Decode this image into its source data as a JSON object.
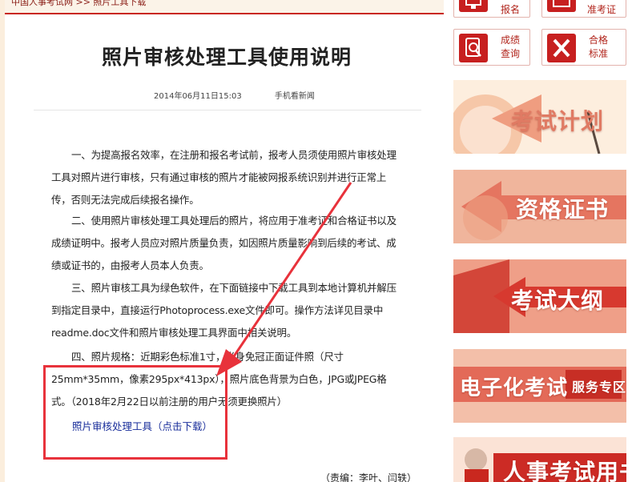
{
  "breadcrumb": "中国人事考试网 >> 照片工具下载",
  "article": {
    "title": "照片审核处理工具使用说明",
    "date": "2014年06月11日15:03",
    "mobile_link": "手机看新闻",
    "paragraphs": [
      "一、为提高报名效率，在注册和报名考试前，报考人员须使用照片审核处理工具对照片进行审核，只有通过审核的照片才能被网报系统识别并进行正常上传，否则无法完成后续报名操作。",
      "二、使用照片审核处理工具处理后的照片，将应用于准考证和合格证书以及成绩证明中。报考人员应对照片质量负责，如因照片质量影响到后续的考试、成绩或证书的，由报考人员本人负责。",
      "三、照片审核工具为绿色软件，在下面链接中下载工具到本地计算机并解压到指定目录中，直接运行Photoprocess.exe文件即可。操作方法详见目录中readme.doc文件和照片审核处理工具界面中相关说明。",
      "四、照片规格：近期彩色标准1寸，半身免冠正面证件照（尺寸25mm*35mm，像素295px*413px），照片底色背景为白色，JPG或JPEG格式。（2018年2月22日以前注册的用户无须更换照片）"
    ],
    "download_link": "照片审核处理工具（点击下载）",
    "editor": "（责编：李叶、闫轶）"
  },
  "sidebar": {
    "top_buttons": [
      {
        "label": "报名",
        "icon": "monitor-icon"
      },
      {
        "label": "准考证",
        "icon": "printer-icon"
      }
    ],
    "buttons": [
      {
        "label_line1": "成绩",
        "label_line2": "查询",
        "icon": "search-icon"
      },
      {
        "label_line1": "合格",
        "label_line2": "标准",
        "icon": "pencil-ruler-icon"
      }
    ],
    "banners": [
      {
        "label": "考试计划",
        "color": "#f6c7a8"
      },
      {
        "label": "资格证书",
        "color": "#e97961"
      },
      {
        "label": "考试大纲",
        "color": "#d93a30"
      },
      {
        "label": "电子化考试",
        "sub": "服务专区",
        "color": "#e56b5c"
      },
      {
        "label": "人事考试用书",
        "color": "#cc2b25"
      }
    ]
  },
  "colors": {
    "accent_red": "#c9281f",
    "highlight_red": "#e8323b",
    "link_blue": "#1a2f9b"
  }
}
